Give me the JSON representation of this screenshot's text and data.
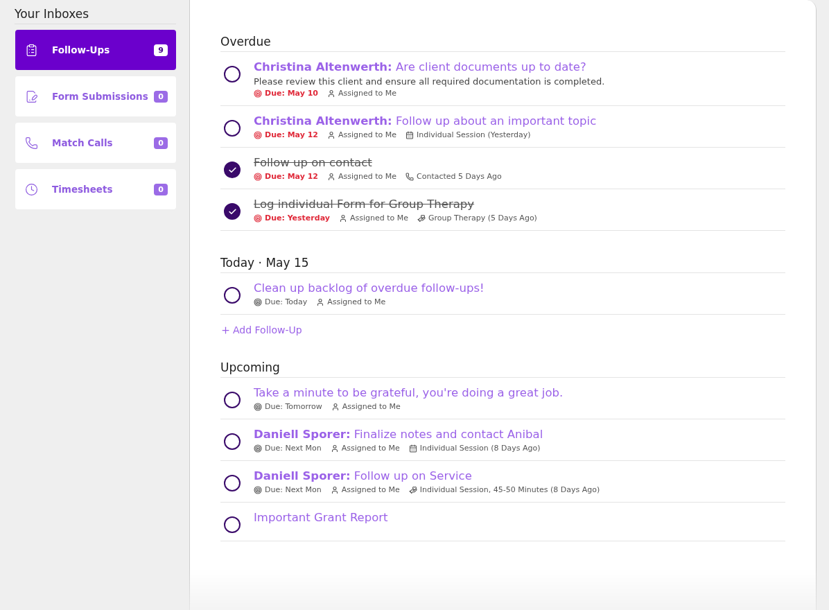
{
  "sidebar": {
    "title": "Your Inboxes",
    "items": [
      {
        "label": "Follow-Ups",
        "count": "9",
        "kind": "followups",
        "selected": true
      },
      {
        "label": "Form Submissions",
        "count": "0",
        "kind": "forms",
        "selected": false
      },
      {
        "label": "Match Calls",
        "count": "0",
        "kind": "calls",
        "selected": false
      },
      {
        "label": "Timesheets",
        "count": "0",
        "kind": "time",
        "selected": false
      }
    ]
  },
  "sections": [
    {
      "title": "Overdue",
      "items": [
        {
          "title": "**Christina Altenwerth:** Are client documents up to date?",
          "description": "Please review this client and ensure all required documentation is completed.",
          "checked": false,
          "meta": [
            {
              "kind": "due",
              "text": "Due: May 10",
              "overdue": true
            },
            {
              "kind": "assignee",
              "text": "Assigned to Me"
            }
          ]
        },
        {
          "title": "**Christina Altenwerth:** Follow up about an important topic",
          "checked": false,
          "meta": [
            {
              "kind": "due",
              "text": "Due: May 12",
              "overdue": true
            },
            {
              "kind": "assignee",
              "text": "Assigned to Me"
            },
            {
              "kind": "session",
              "text": "Individual Session (Yesterday)"
            }
          ]
        },
        {
          "title": "Follow up on contact",
          "checked": true,
          "meta": [
            {
              "kind": "due",
              "text": "Due: May 12",
              "overdue": true
            },
            {
              "kind": "assignee",
              "text": "Assigned to Me"
            },
            {
              "kind": "call",
              "text": "Contacted 5 Days Ago"
            }
          ]
        },
        {
          "title": "Log individual Form for Group Therapy",
          "checked": true,
          "meta": [
            {
              "kind": "due",
              "text": "Due: Yesterday",
              "overdue": true
            },
            {
              "kind": "assignee",
              "text": "Assigned to Me"
            },
            {
              "kind": "care",
              "text": "Group Therapy (5 Days Ago)"
            }
          ]
        }
      ]
    },
    {
      "title": "Today · May 15",
      "add_button": "Add Follow-Up",
      "items": [
        {
          "title": "Clean up backlog of overdue follow-ups!",
          "checked": false,
          "meta": [
            {
              "kind": "due",
              "text": "Due: Today",
              "overdue": false
            },
            {
              "kind": "assignee",
              "text": "Assigned to Me"
            }
          ]
        }
      ]
    },
    {
      "title": "Upcoming",
      "items": [
        {
          "title": "Take a minute to be grateful, you're doing a great job.",
          "checked": false,
          "meta": [
            {
              "kind": "due",
              "text": "Due: Tomorrow",
              "overdue": false
            },
            {
              "kind": "assignee",
              "text": "Assigned to Me"
            }
          ]
        },
        {
          "title": "**Daniell Sporer:** Finalize notes and contact Anibal",
          "checked": false,
          "meta": [
            {
              "kind": "due",
              "text": "Due: Next Mon",
              "overdue": false
            },
            {
              "kind": "assignee",
              "text": "Assigned to Me"
            },
            {
              "kind": "session",
              "text": "Individual Session (8 Days Ago)"
            }
          ]
        },
        {
          "title": "**Daniell Sporer:** Follow up on Service",
          "checked": false,
          "meta": [
            {
              "kind": "due",
              "text": "Due: Next Mon",
              "overdue": false
            },
            {
              "kind": "assignee",
              "text": "Assigned to Me"
            },
            {
              "kind": "care",
              "text": "Individual Session, 45-50 Minutes (8 Days Ago)"
            }
          ]
        },
        {
          "title": "Important Grant Report",
          "checked": false
        }
      ]
    }
  ]
}
